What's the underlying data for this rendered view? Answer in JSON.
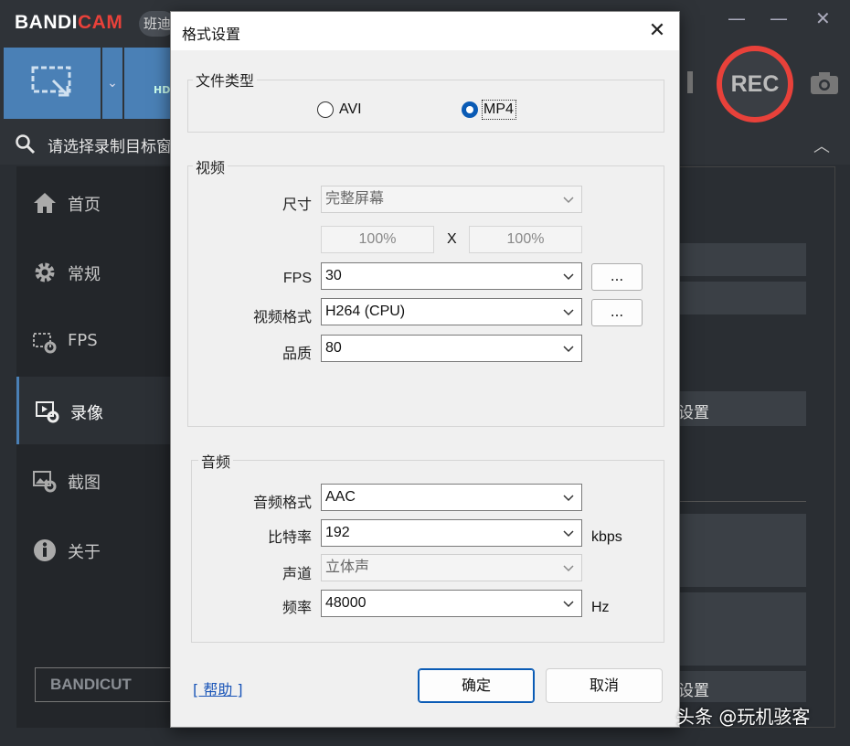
{
  "app": {
    "logo_part1": "BANDI",
    "logo_part2": "CAM",
    "logo_badge": "班迪",
    "search_prompt": "请选择录制目标窗",
    "rec_label": "REC",
    "hdmi_label": "HD",
    "bandicut_label": "BANDICUT",
    "sidebar": [
      {
        "label": "首页",
        "icon": "home-icon"
      },
      {
        "label": "常规",
        "icon": "gear-icon"
      },
      {
        "label": "FPS",
        "icon": "fps-icon"
      },
      {
        "label": "录像",
        "icon": "video-settings-icon",
        "active": true
      },
      {
        "label": "截图",
        "icon": "image-settings-icon"
      },
      {
        "label": "关于",
        "icon": "info-icon"
      }
    ],
    "right_fragment_1": "设置",
    "right_fragment_2": "设置"
  },
  "dialog": {
    "title": "格式设置",
    "file_type": {
      "group_label": "文件类型",
      "options": [
        "AVI",
        "MP4"
      ],
      "selected": "MP4"
    },
    "video": {
      "group_label": "视频",
      "size_label": "尺寸",
      "size_value": "完整屏幕",
      "width_pct": "100%",
      "times": "X",
      "height_pct": "100%",
      "fps_label": "FPS",
      "fps_value": "30",
      "format_label": "视频格式",
      "format_value": "H264 (CPU)",
      "quality_label": "品质",
      "quality_value": "80",
      "more_button": "..."
    },
    "audio": {
      "group_label": "音频",
      "format_label": "音频格式",
      "format_value": "AAC",
      "bitrate_label": "比特率",
      "bitrate_value": "192",
      "bitrate_unit": "kbps",
      "channel_label": "声道",
      "channel_value": "立体声",
      "freq_label": "频率",
      "freq_value": "48000",
      "freq_unit": "Hz"
    },
    "help_link": "[ 帮助 ]",
    "ok_button": "确定",
    "cancel_button": "取消"
  },
  "watermark": "头条 @玩机骇客",
  "colors": {
    "accent": "#0a5bb5",
    "bandicam_red": "#e8413a",
    "toolbar_blue": "#4a80b6"
  }
}
